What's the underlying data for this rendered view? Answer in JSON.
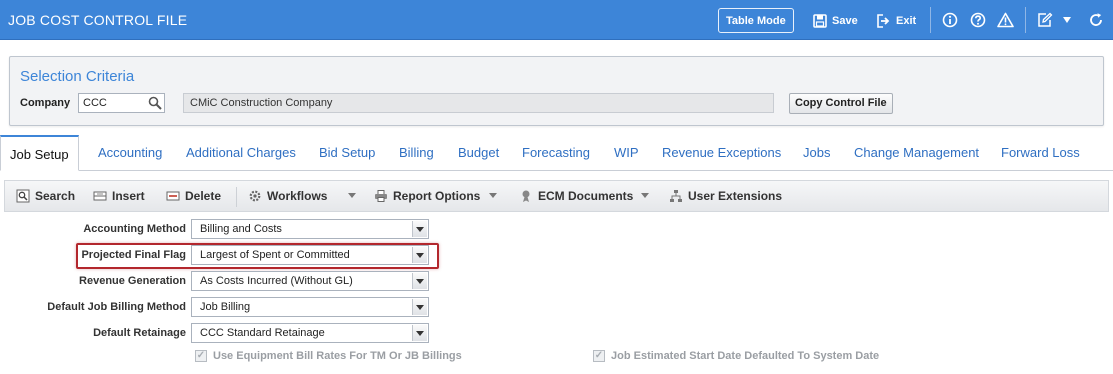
{
  "header": {
    "title": "JOB COST CONTROL FILE",
    "table_mode_label": "Table Mode",
    "save_label": "Save",
    "exit_label": "Exit"
  },
  "selection": {
    "title": "Selection Criteria",
    "company_label": "Company",
    "company_value": "CCC",
    "company_name": "CMiC Construction Company",
    "copy_button_label": "Copy Control File"
  },
  "tabs": [
    {
      "label": "Job Setup"
    },
    {
      "label": "Accounting"
    },
    {
      "label": "Additional Charges"
    },
    {
      "label": "Bid Setup"
    },
    {
      "label": "Billing"
    },
    {
      "label": "Budget"
    },
    {
      "label": "Forecasting"
    },
    {
      "label": "WIP"
    },
    {
      "label": "Revenue Exceptions"
    },
    {
      "label": "Jobs"
    },
    {
      "label": "Change Management"
    },
    {
      "label": "Forward Loss"
    }
  ],
  "toolbar": {
    "search_label": "Search",
    "insert_label": "Insert",
    "delete_label": "Delete",
    "workflows_label": "Workflows",
    "report_options_label": "Report Options",
    "ecm_documents_label": "ECM Documents",
    "user_extensions_label": "User Extensions"
  },
  "form": {
    "fields": [
      {
        "label": "Accounting Method",
        "value": "Billing and Costs"
      },
      {
        "label": "Projected Final Flag",
        "value": "Largest of Spent or Committed"
      },
      {
        "label": "Revenue Generation",
        "value": "As Costs Incurred (Without GL)"
      },
      {
        "label": "Default Job Billing Method",
        "value": "Job Billing"
      },
      {
        "label": "Default Retainage",
        "value": "CCC Standard Retainage"
      }
    ],
    "checkboxes": [
      {
        "label": "Use Equipment Bill Rates For TM Or JB Billings",
        "checked": true
      },
      {
        "label": "Job Estimated Start Date Defaulted To System Date",
        "checked": true
      }
    ]
  },
  "colors": {
    "header_bg": "#3d85d8",
    "tab_link": "#2f6fc2",
    "highlight": "#b3272d"
  }
}
